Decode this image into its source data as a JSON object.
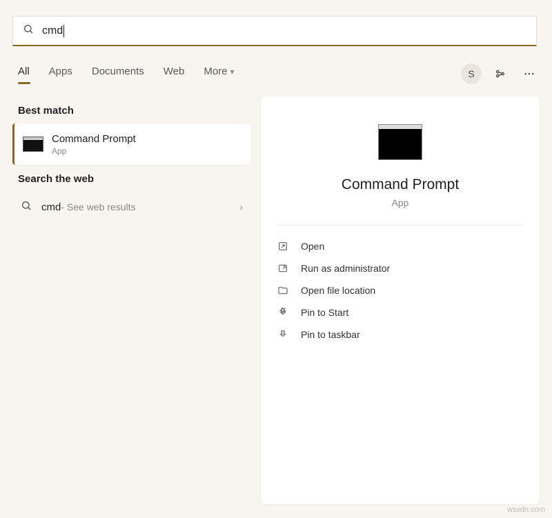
{
  "search": {
    "value": "cmd"
  },
  "tabs": {
    "items": [
      "All",
      "Apps",
      "Documents",
      "Web",
      "More"
    ],
    "active_index": 0
  },
  "avatar_initial": "S",
  "left": {
    "best_match": {
      "header": "Best match",
      "title": "Command Prompt",
      "subtitle": "App"
    },
    "web": {
      "header": "Search the web",
      "query": "cmd",
      "hint": " - See web results"
    }
  },
  "preview": {
    "title": "Command Prompt",
    "subtitle": "App",
    "actions": {
      "open": "Open",
      "run_admin": "Run as administrator",
      "open_location": "Open file location",
      "pin_start": "Pin to Start",
      "pin_taskbar": "Pin to taskbar"
    }
  },
  "watermark": "wsxdn.com"
}
